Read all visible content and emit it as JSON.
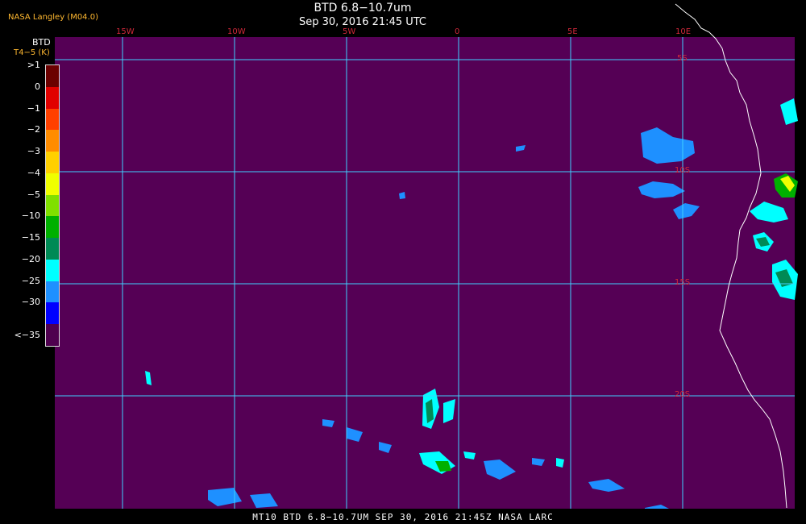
{
  "title": "BTD 6.8−10.7um",
  "subtitle": "Sep 30, 2016 21:45 UTC",
  "agency": "NASA Langley (M04.0)",
  "colorbar": {
    "title": "BTD",
    "subtitle": "T4−5 (K)",
    "labels": [
      ">1",
      "0",
      "−1",
      "−2",
      "−3",
      "−4",
      "−5",
      "−10",
      "−15",
      "−20",
      "−25",
      "−30",
      "<−35"
    ],
    "colors": [
      "#6b0000",
      "#e10000",
      "#ff4000",
      "#ff8c00",
      "#ffd000",
      "#f0ff00",
      "#80e000",
      "#00b000",
      "#008a55",
      "#00ffff",
      "#1e90ff",
      "#0000ff",
      "#4f004f"
    ]
  },
  "lon_labels": [
    "15W",
    "10W",
    "5W",
    "0",
    "5E",
    "10E"
  ],
  "lat_labels": [
    "5S",
    "10S",
    "15S",
    "20S"
  ],
  "footer": "MT10   BTD 6.8−10.7UM    SEP 30, 2016 21:45Z    NASA LARC",
  "colors": {
    "background": "#550055",
    "grid": "#40d0ff",
    "coast": "#ffffff",
    "label": "#d0283a"
  }
}
